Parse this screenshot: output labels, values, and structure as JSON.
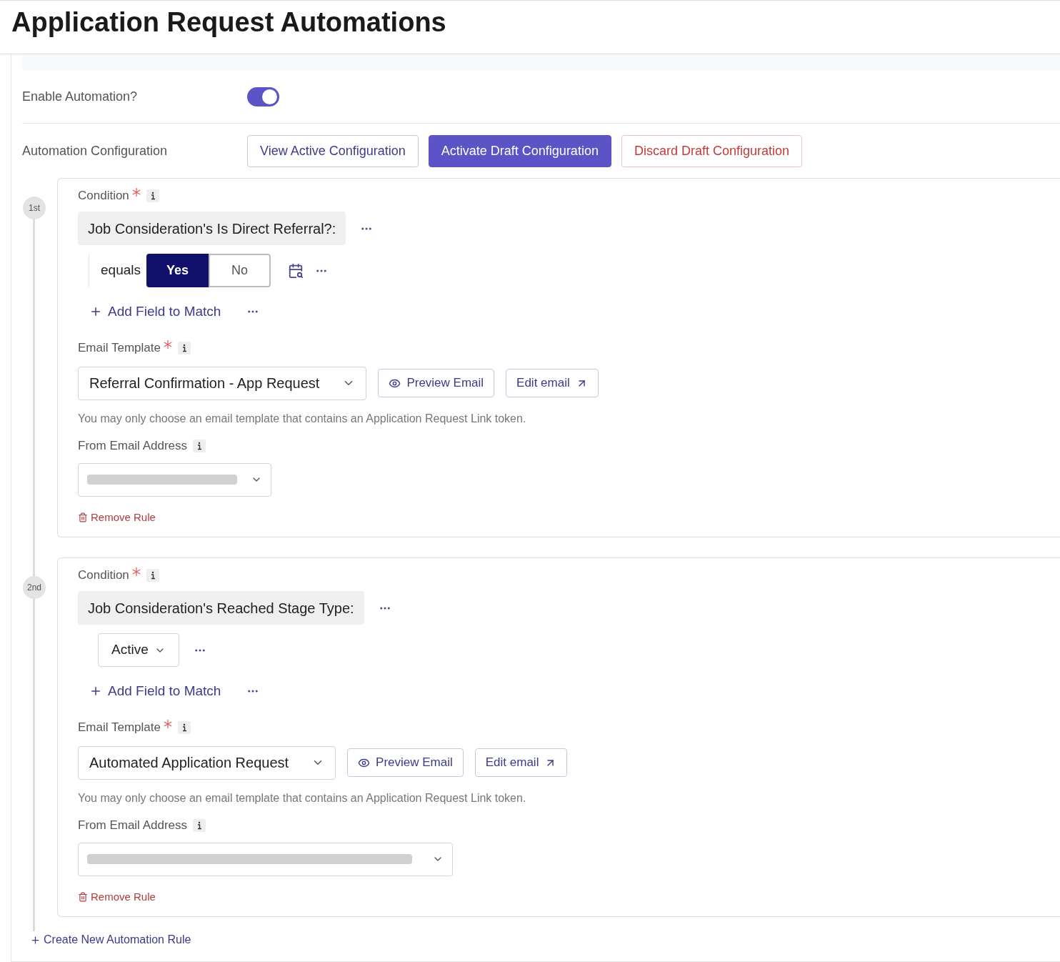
{
  "title": "Application Request Automations",
  "enable": {
    "label": "Enable Automation?",
    "on": true
  },
  "config": {
    "label": "Automation Configuration",
    "buttons": [
      {
        "label": "View Active Configuration",
        "kind": "outline"
      },
      {
        "label": "Activate Draft Configuration",
        "kind": "primary"
      },
      {
        "label": "Discard Draft Configuration",
        "kind": "danger"
      }
    ]
  },
  "rules": [
    {
      "step": "1st",
      "condition_label": "Condition",
      "condition_required": true,
      "field": "Job Consideration's Is Direct Referral?:",
      "matcher": {
        "kind": "toggle",
        "operator": "equals",
        "options": [
          {
            "label": "Yes",
            "selected": true
          },
          {
            "label": "No",
            "selected": false
          }
        ]
      },
      "add_field": "Add Field to Match",
      "template_label": "Email Template",
      "template_required": true,
      "template": "Referral Confirmation - App Request",
      "preview": "Preview Email",
      "edit": "Edit email",
      "hint": "You may only choose an email template that contains an Application Request Link token.",
      "from_label": "From Email Address",
      "remove": "Remove Rule"
    },
    {
      "step": "2nd",
      "condition_label": "Condition",
      "condition_required": true,
      "field": "Job Consideration's Reached Stage Type:",
      "matcher": {
        "kind": "dropdown",
        "value": "Active"
      },
      "add_field": "Add Field to Match",
      "template_label": "Email Template",
      "template_required": true,
      "template": "Automated Application Request",
      "preview": "Preview Email",
      "edit": "Edit email",
      "hint": "You may only choose an email template that contains an Application Request Link token.",
      "from_label": "From Email Address",
      "remove": "Remove Rule"
    }
  ],
  "create": "Create New Automation Rule"
}
